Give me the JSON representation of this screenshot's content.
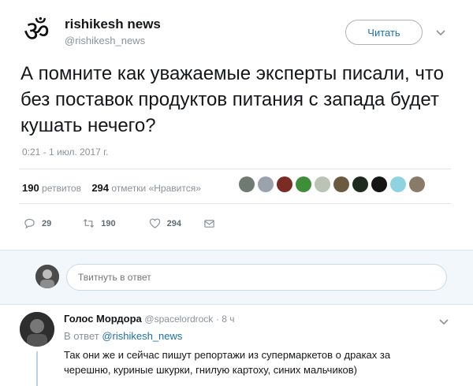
{
  "account": {
    "name": "rishikesh news",
    "handle": "@rishikesh_news",
    "follow_label": "Читать"
  },
  "tweet": {
    "text": "А помните как уважаемые эксперты писали, что без поставок продуктов питания с запада будет кушать нечего?",
    "timestamp": "0:21 - 1 июл. 2017 г.",
    "retweets_count": "190",
    "retweets_label": "ретвитов",
    "likes_count": "294",
    "likes_label": "отметки «Нравится»"
  },
  "actions": {
    "reply_count": "29",
    "retweet_count": "190",
    "like_count": "294"
  },
  "reply_box": {
    "placeholder": "Твитнуть в ответ"
  },
  "comment": {
    "name": "Голос Мордора",
    "handle": "@spacelordrock",
    "time": "· 8 ч",
    "reply_prefix": "В ответ",
    "reply_to": "@rishikesh_news",
    "text": "Так они же и сейчас пишут репортажи из супермаркетов о драках за черешню, куриные шкурки, гнилую картоху, синих мальчиков)"
  },
  "colors": {
    "link": "#1d6fa5",
    "muted": "#8a9299",
    "reply_bar_bg": "#f1f7fb"
  }
}
